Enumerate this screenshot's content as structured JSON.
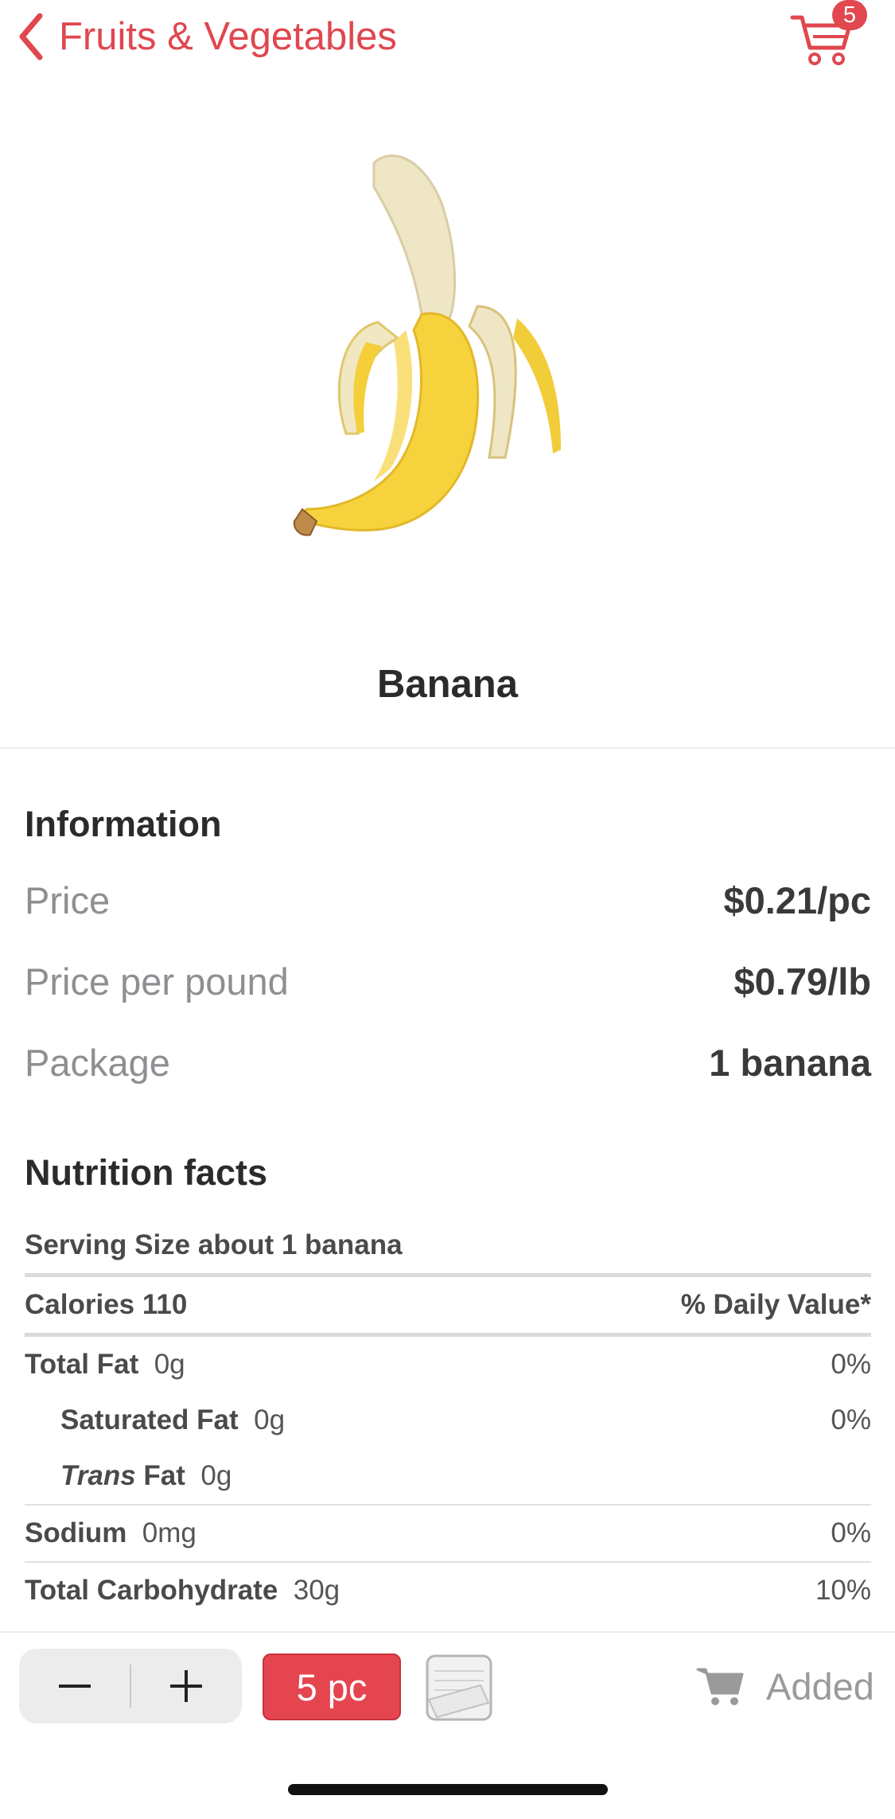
{
  "nav": {
    "back_label": "Fruits & Vegetables",
    "cart_count": "5"
  },
  "product": {
    "name": "Banana",
    "image": "banana-image"
  },
  "information": {
    "title": "Information",
    "rows": [
      {
        "label": "Price",
        "value": "$0.21/pc"
      },
      {
        "label": "Price per pound",
        "value": "$0.79/lb"
      },
      {
        "label": "Package",
        "value": "1 banana"
      }
    ]
  },
  "nutrition": {
    "title": "Nutrition facts",
    "serving": "Serving Size about 1 banana",
    "calories_label": "Calories 110",
    "daily_value_header": "% Daily Value*",
    "total_fat": {
      "label": "Total Fat",
      "amount": "0g",
      "dv": "0%"
    },
    "saturated_fat": {
      "label": "Saturated Fat",
      "amount": "0g",
      "dv": "0%"
    },
    "trans_fat": {
      "label_italic": "Trans",
      "label": "Fat",
      "amount": "0g"
    },
    "sodium": {
      "label": "Sodium",
      "amount": "0mg",
      "dv": "0%"
    },
    "total_carbohydrate": {
      "label": "Total Carbohydrate",
      "amount": "30g",
      "dv": "10%"
    }
  },
  "bottom_bar": {
    "quantity": "5 pc",
    "added_label": "Added"
  },
  "colors": {
    "accent": "#e0474f"
  }
}
